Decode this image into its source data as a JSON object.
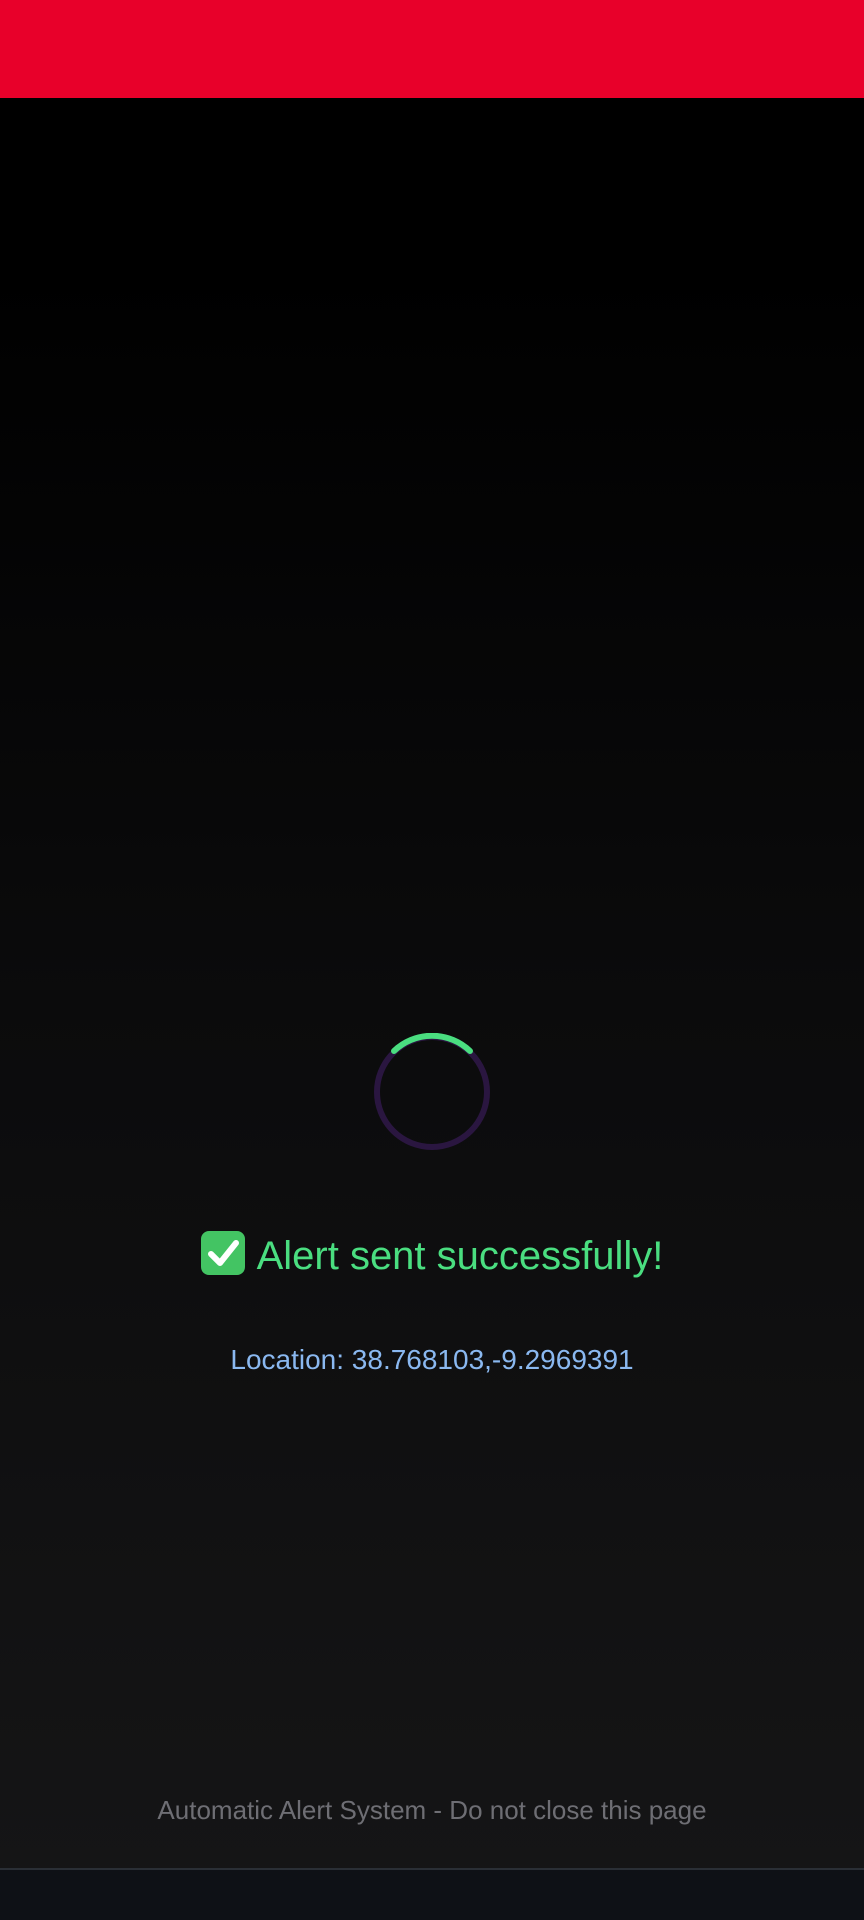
{
  "header": {
    "bar_color": "#e8002a"
  },
  "spinner": {
    "icon": "loading-spinner-icon",
    "track_color": "#2a1640",
    "arc_color": "#4ade80"
  },
  "status": {
    "icon": "check-mark-icon",
    "message": "Alert sent successfully!",
    "color": "#4ade80"
  },
  "location": {
    "text": "Location: 38.768103,-9.2969391",
    "color": "#8ab8f0"
  },
  "footer": {
    "text": "Automatic Alert System - Do not close this page"
  }
}
